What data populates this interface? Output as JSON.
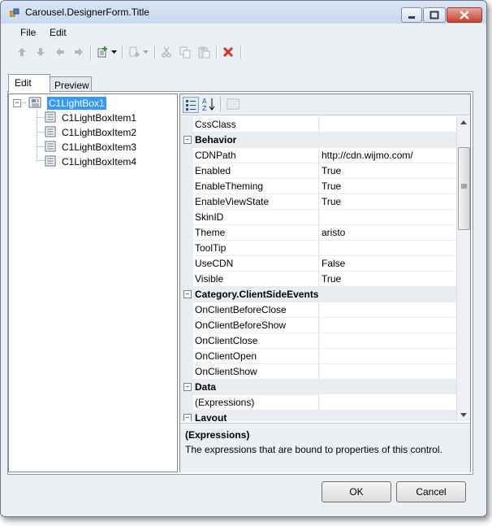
{
  "window": {
    "title": "Carousel.DesignerForm.Title"
  },
  "menu": {
    "file": "File",
    "edit": "Edit"
  },
  "toolbar": {
    "icons": [
      "move-up-icon",
      "move-down-icon",
      "move-left-icon",
      "move-right-icon",
      "insert-item-icon",
      "dropdown-arrow-icon",
      "add-child-icon",
      "dropdown-arrow-icon",
      "cut-icon",
      "copy-icon",
      "paste-icon",
      "delete-icon"
    ]
  },
  "tabs": {
    "edit": "Edit",
    "preview": "Preview"
  },
  "tree": {
    "root": "C1LightBox1",
    "items": [
      "C1LightBoxItem1",
      "C1LightBoxItem2",
      "C1LightBoxItem3",
      "C1LightBoxItem4"
    ]
  },
  "property_grid": {
    "rows": [
      {
        "type": "prop",
        "name": "CssClass",
        "value": ""
      },
      {
        "type": "cat",
        "name": "Behavior"
      },
      {
        "type": "prop",
        "name": "CDNPath",
        "value": "http://cdn.wijmo.com/"
      },
      {
        "type": "prop",
        "name": "Enabled",
        "value": "True"
      },
      {
        "type": "prop",
        "name": "EnableTheming",
        "value": "True"
      },
      {
        "type": "prop",
        "name": "EnableViewState",
        "value": "True"
      },
      {
        "type": "prop",
        "name": "SkinID",
        "value": ""
      },
      {
        "type": "prop",
        "name": "Theme",
        "value": "aristo"
      },
      {
        "type": "prop",
        "name": "ToolTip",
        "value": ""
      },
      {
        "type": "prop",
        "name": "UseCDN",
        "value": "False"
      },
      {
        "type": "prop",
        "name": "Visible",
        "value": "True"
      },
      {
        "type": "cat",
        "name": "Category.ClientSideEvents"
      },
      {
        "type": "prop",
        "name": "OnClientBeforeClose",
        "value": ""
      },
      {
        "type": "prop",
        "name": "OnClientBeforeShow",
        "value": ""
      },
      {
        "type": "prop",
        "name": "OnClientClose",
        "value": ""
      },
      {
        "type": "prop",
        "name": "OnClientOpen",
        "value": ""
      },
      {
        "type": "prop",
        "name": "OnClientShow",
        "value": ""
      },
      {
        "type": "cat",
        "name": "Data"
      },
      {
        "type": "prop",
        "name": "(Expressions)",
        "value": ""
      },
      {
        "type": "cat",
        "name": "Layout"
      }
    ],
    "description": {
      "title": "(Expressions)",
      "text": "The expressions that are bound to properties of this control."
    }
  },
  "buttons": {
    "ok": "OK",
    "cancel": "Cancel"
  },
  "colors": {
    "selection": "#3399ff",
    "close_button": "#c8422b",
    "delete_icon": "#d0302a"
  }
}
